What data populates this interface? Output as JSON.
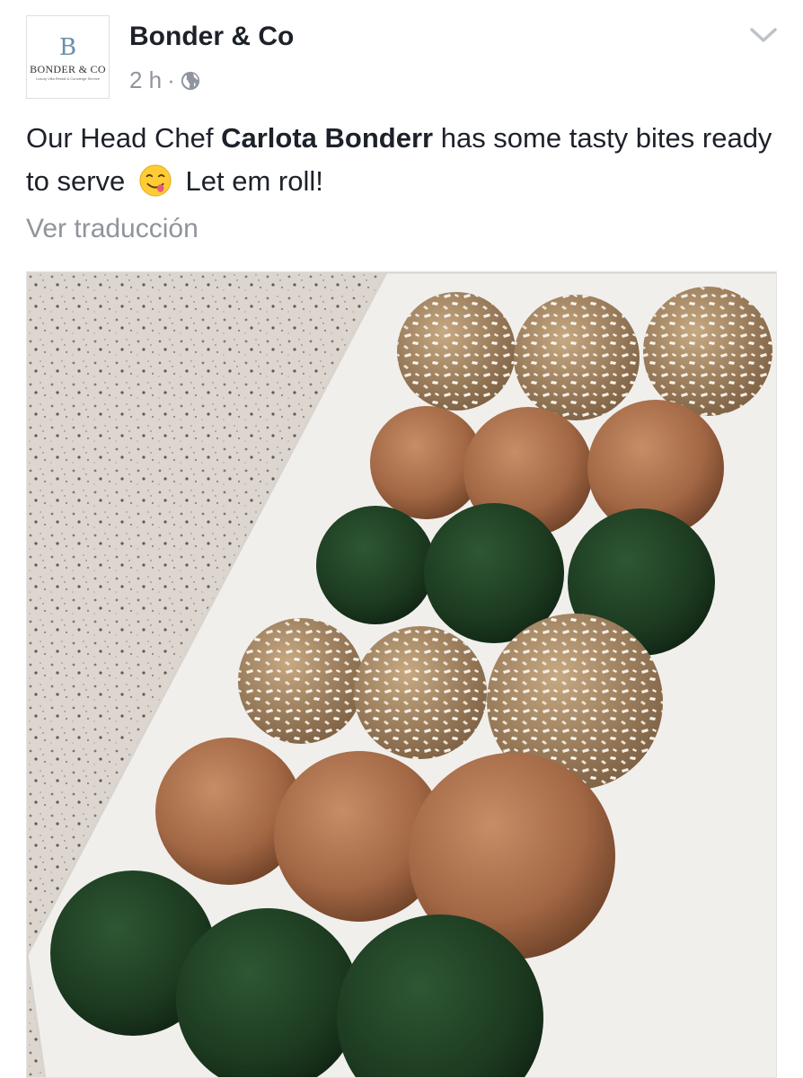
{
  "post": {
    "author": "Bonder & Co",
    "time": "2 h",
    "separator": "·",
    "privacy_icon": "globe-icon",
    "menu_icon": "chevron-down-icon",
    "avatar": {
      "monogram": "B",
      "brand": "BONDER & CO",
      "tagline": "Luxury Villa Rental & Concierge Service"
    },
    "text": {
      "before_mention": "Our Head Chef ",
      "mention": "Carlota Bonderr",
      "after_mention_line": " has some tasty bites ready to serve",
      "emoji": "face-savoring-food-emoji",
      "after_emoji": " Let em roll!"
    },
    "translate_label": "Ver traducción",
    "photo_description_icon": "photo"
  },
  "colors": {
    "text_primary": "#1d2129",
    "text_secondary": "#90949c",
    "matcha": "#1f3d23",
    "cocoa": "#a86b46",
    "coconut": "#efe6d6"
  }
}
